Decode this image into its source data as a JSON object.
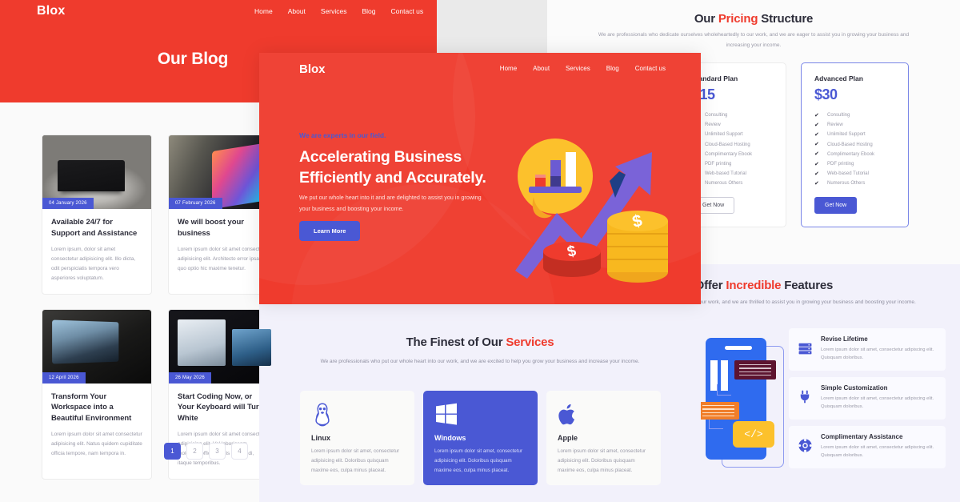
{
  "brand": {
    "name": "Blox",
    "red": "#ef3b2d",
    "indigo": "#4a58d4"
  },
  "blog_page": {
    "nav": {
      "logo": "Blox",
      "links": [
        "Home",
        "About",
        "Services",
        "Blog",
        "Contact us"
      ]
    },
    "hero_title": "Our Blog",
    "posts": [
      {
        "date": "04 January 2026",
        "title": "Available 24/7 for Support and Assistance",
        "excerpt": "Lorem ipsum, dolor sit amet consectetur adipisicing elit. Illo dicta, odit perspiciatis tempora vero asperiores voluptatum."
      },
      {
        "date": "07 February 2026",
        "title": "We will boost your business",
        "excerpt": "Lorem ipsum dolor sit amet consectetur adipisicing elit. Architecto error ipsam quo optio hic maxime tenetur."
      },
      {
        "date": "12 April 2026",
        "title": "Transform Your Workspace into a Beautiful Environment",
        "excerpt": "Lorem ipsum dolor sit amet consectetur adipisicing elit. Natus quidem cupiditate officia tempore, nam tempora in."
      },
      {
        "date": "26 May 2026",
        "title": "Start Coding Now, or Your Keyboard will Turn White",
        "excerpt": "Lorem ipsum dolor sit amet consectetur adipisicing elit. Vel laboriosam molestias officiis facilis commodi, itaque temporibus."
      }
    ],
    "pagination": [
      "1",
      "2",
      "3",
      "4"
    ],
    "pagination_active": "1"
  },
  "hero_overlay": {
    "logo": "Blox",
    "nav": [
      "Home",
      "About",
      "Services",
      "Blog",
      "Contact us"
    ],
    "eyebrow": "We are experts in our field.",
    "heading_line1": "Accelerating Business",
    "heading_line2": "Efficiently and Accurately.",
    "subtext": "We put our whole heart into it and are delighted to assist you in growing your business and boosting your income.",
    "cta": "Learn More",
    "illustration": "growth-chart-coins-illustration"
  },
  "pricing": {
    "title_pre": "Our ",
    "title_hl": "Pricing",
    "title_post": " Structure",
    "subtitle": "We are professionals who dedicate ourselves wholeheartedly to our work, and we are eager to assist you in growing your business and increasing your income.",
    "features": [
      "Consulting",
      "Review",
      "Unlimited Support",
      "Cloud-Based Hosting",
      "Complimentary Ebook",
      "PDF printing",
      "Web-based Tutorial",
      "Numerous Others"
    ],
    "plans": [
      {
        "name": "Standard Plan",
        "price": "$15",
        "button": "Get Now",
        "featured": false
      },
      {
        "name": "Advanced Plan",
        "price": "$30",
        "button": "Get Now",
        "featured": true
      }
    ]
  },
  "features": {
    "title_pre": "We Offer ",
    "title_hl": "Incredible",
    "title_post": " Features",
    "subtitle": "We are professionals who pour our hearts into our work, and we are thrilled to assist you in growing your business and boosting your income.",
    "items": [
      {
        "icon": "server-icon",
        "title": "Revise Lifetime",
        "text": "Lorem ipsum dolor sit amet, consectetur adipiscing elit. Quisquam doloribus."
      },
      {
        "icon": "plug-icon",
        "title": "Simple Customization",
        "text": "Lorem ipsum dolor sit amet, consectetur adipiscing elit. Quisquam doloribus."
      },
      {
        "icon": "lifebuoy-icon",
        "title": "Complimentary Assistance",
        "text": "Lorem ipsum dolor sit amet, consectetur adipiscing elit. Quisquam doloribus."
      }
    ],
    "illustration": "mobile-code-illustration"
  },
  "services": {
    "title_pre": "The Finest of Our ",
    "title_hl": "Services",
    "title_post": "",
    "subtitle": "We are professionals who put our whole heart into our work, and we are excited to help you grow your business and increase your income.",
    "cards": [
      {
        "icon": "linux-penguin-icon",
        "name": "Linux",
        "active": false,
        "text": "Lorem ipsum dolor sit amet, consectetur adipisicing elit. Doloribus quisquam maxime eos, culpa minus placeat."
      },
      {
        "icon": "windows-icon",
        "name": "Windows",
        "active": true,
        "text": "Lorem ipsum dolor sit amet, consectetur adipisicing elit. Doloribus quisquam maxime eos, culpa minus placeat."
      },
      {
        "icon": "apple-icon",
        "name": "Apple",
        "active": false,
        "text": "Lorem ipsum dolor sit amet, consectetur adipisicing elit. Doloribus quisquam maxime eos, culpa minus placeat."
      }
    ]
  }
}
